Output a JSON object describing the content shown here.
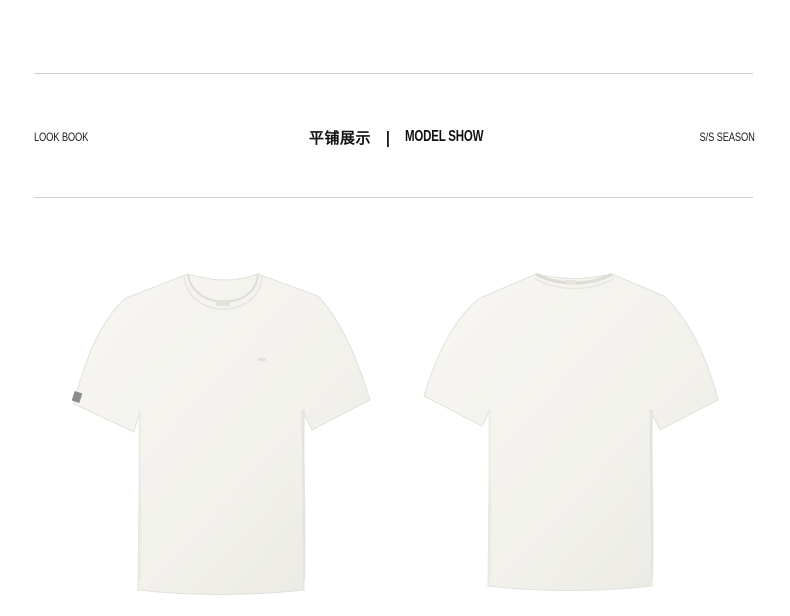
{
  "header": {
    "left_label": "LOOK BOOK",
    "center_cn": "平铺展示",
    "center_separator": "|",
    "center_en": "MODEL SHOW",
    "right_label": "S/S SEASON"
  },
  "products": [
    {
      "view": "front",
      "color": "#f4f3ef"
    },
    {
      "view": "back",
      "color": "#f4f3ef"
    }
  ],
  "colors": {
    "divider": "#cfcfcf",
    "text": "#1a1a1a",
    "background": "#ffffff"
  }
}
